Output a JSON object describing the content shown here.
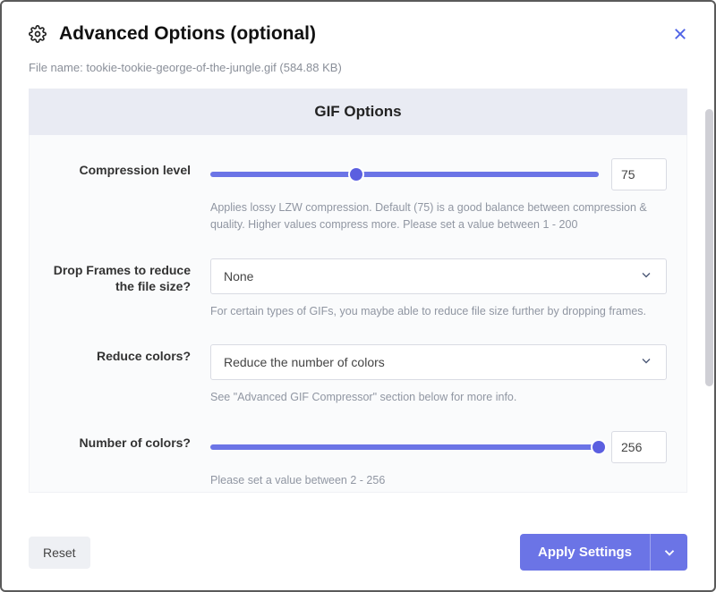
{
  "header": {
    "title": "Advanced Options (optional)"
  },
  "file": {
    "label": "File name:",
    "name_and_size": "tookie-tookie-george-of-the-jungle.gif (584.88 KB)"
  },
  "section": {
    "title": "GIF Options"
  },
  "compression": {
    "label": "Compression level",
    "value": "75",
    "fill_pct": 37.5,
    "track_pct": 100,
    "help": "Applies lossy LZW compression. Default (75) is a good balance between compression & quality. Higher values compress more. Please set a value between 1 - 200"
  },
  "drop_frames": {
    "label": "Drop Frames to reduce the file size?",
    "value": "None",
    "help": "For certain types of GIFs, you maybe able to reduce file size further by dropping frames."
  },
  "reduce_colors": {
    "label": "Reduce colors?",
    "value": "Reduce the number of colors",
    "help": "See \"Advanced GIF Compressor\" section below for more info."
  },
  "num_colors": {
    "label": "Number of colors?",
    "value": "256",
    "fill_pct": 100,
    "help": "Please set a value between 2 - 256"
  },
  "footer": {
    "reset": "Reset",
    "apply": "Apply Settings"
  }
}
